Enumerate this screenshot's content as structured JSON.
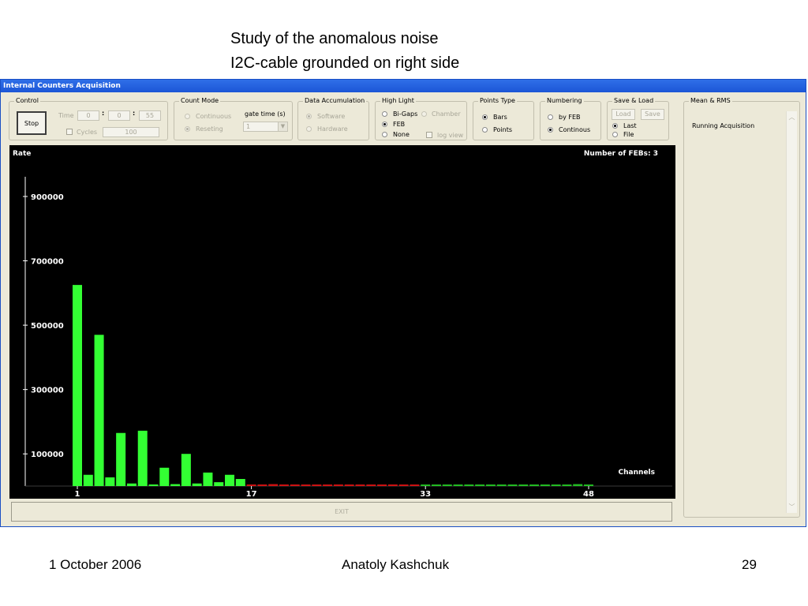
{
  "slide": {
    "title_line1": "Study of the anomalous noise",
    "title_line2": "I2C-cable grounded on right side",
    "footer_date": "1 October 2006",
    "footer_author": "Anatoly Kashchuk",
    "footer_page": "29"
  },
  "window": {
    "title": "Internal Counters Acquisition"
  },
  "control": {
    "legend": "Control",
    "stop_label": "Stop",
    "time_label": "Time",
    "time_h": "0",
    "time_m": "0",
    "time_s": "55",
    "sep": ":",
    "cycles_label": "Cycles",
    "cycles_value": "100"
  },
  "count_mode": {
    "legend": "Count Mode",
    "continuous": "Continuous",
    "reseting": "Reseting",
    "gate_label": "gate time (s)",
    "gate_value": "1"
  },
  "data_accumulation": {
    "legend": "Data Accumulation",
    "software": "Software",
    "hardware": "Hardware"
  },
  "high_light": {
    "legend": "High Light",
    "bigaps": "Bi-Gaps",
    "chamber": "Chamber",
    "feb": "FEB",
    "none": "None",
    "logview": "log view"
  },
  "points_type": {
    "legend": "Points Type",
    "bars": "Bars",
    "points": "Points"
  },
  "numbering": {
    "legend": "Numbering",
    "by_feb": "by FEB",
    "continous": "Continous"
  },
  "save_load": {
    "legend": "Save & Load",
    "load": "Load",
    "save": "Save",
    "last": "Last",
    "file": "File"
  },
  "mean_rms": {
    "legend": "Mean & RMS",
    "status": "Running Acquisition"
  },
  "exit_label": "EXIT",
  "chart_data": {
    "type": "bar",
    "ylabel": "Rate",
    "xlabel": "Channels",
    "header_right": "Number of FEBs:  3",
    "ylim": [
      0,
      1000000
    ],
    "y_ticks": [
      "900000",
      "700000",
      "500000",
      "300000",
      "100000"
    ],
    "y_tick_values": [
      900000,
      700000,
      500000,
      300000,
      100000
    ],
    "x_ticks": [
      "1",
      "17",
      "33",
      "48"
    ],
    "x_tick_values": [
      1,
      17,
      33,
      48
    ],
    "x": [
      1,
      2,
      3,
      4,
      5,
      6,
      7,
      8,
      9,
      10,
      11,
      12,
      13,
      14,
      15,
      16,
      17,
      18,
      19,
      20,
      21,
      22,
      23,
      24,
      25,
      26,
      27,
      28,
      29,
      30,
      31,
      32,
      33,
      34,
      35,
      36,
      37,
      38,
      39,
      40,
      41,
      42,
      43,
      44,
      45,
      46,
      47,
      48
    ],
    "values": [
      625000,
      35000,
      470000,
      27000,
      165000,
      8000,
      172000,
      5000,
      57000,
      6000,
      100000,
      8000,
      42000,
      12000,
      35000,
      22000,
      5000,
      5000,
      6000,
      5000,
      5000,
      4000,
      4000,
      4000,
      5000,
      4000,
      4000,
      4000,
      4000,
      5000,
      4000,
      4000,
      4000,
      4000,
      3000,
      3000,
      3000,
      3000,
      3000,
      3000,
      3000,
      3000,
      3000,
      3000,
      3000,
      3000,
      6000,
      4000
    ],
    "colors": {
      "feb1": "#33ff33",
      "feb2": "#cc1111",
      "feb3": "#22bb22",
      "background": "#000000",
      "axis": "#ffffff"
    }
  }
}
